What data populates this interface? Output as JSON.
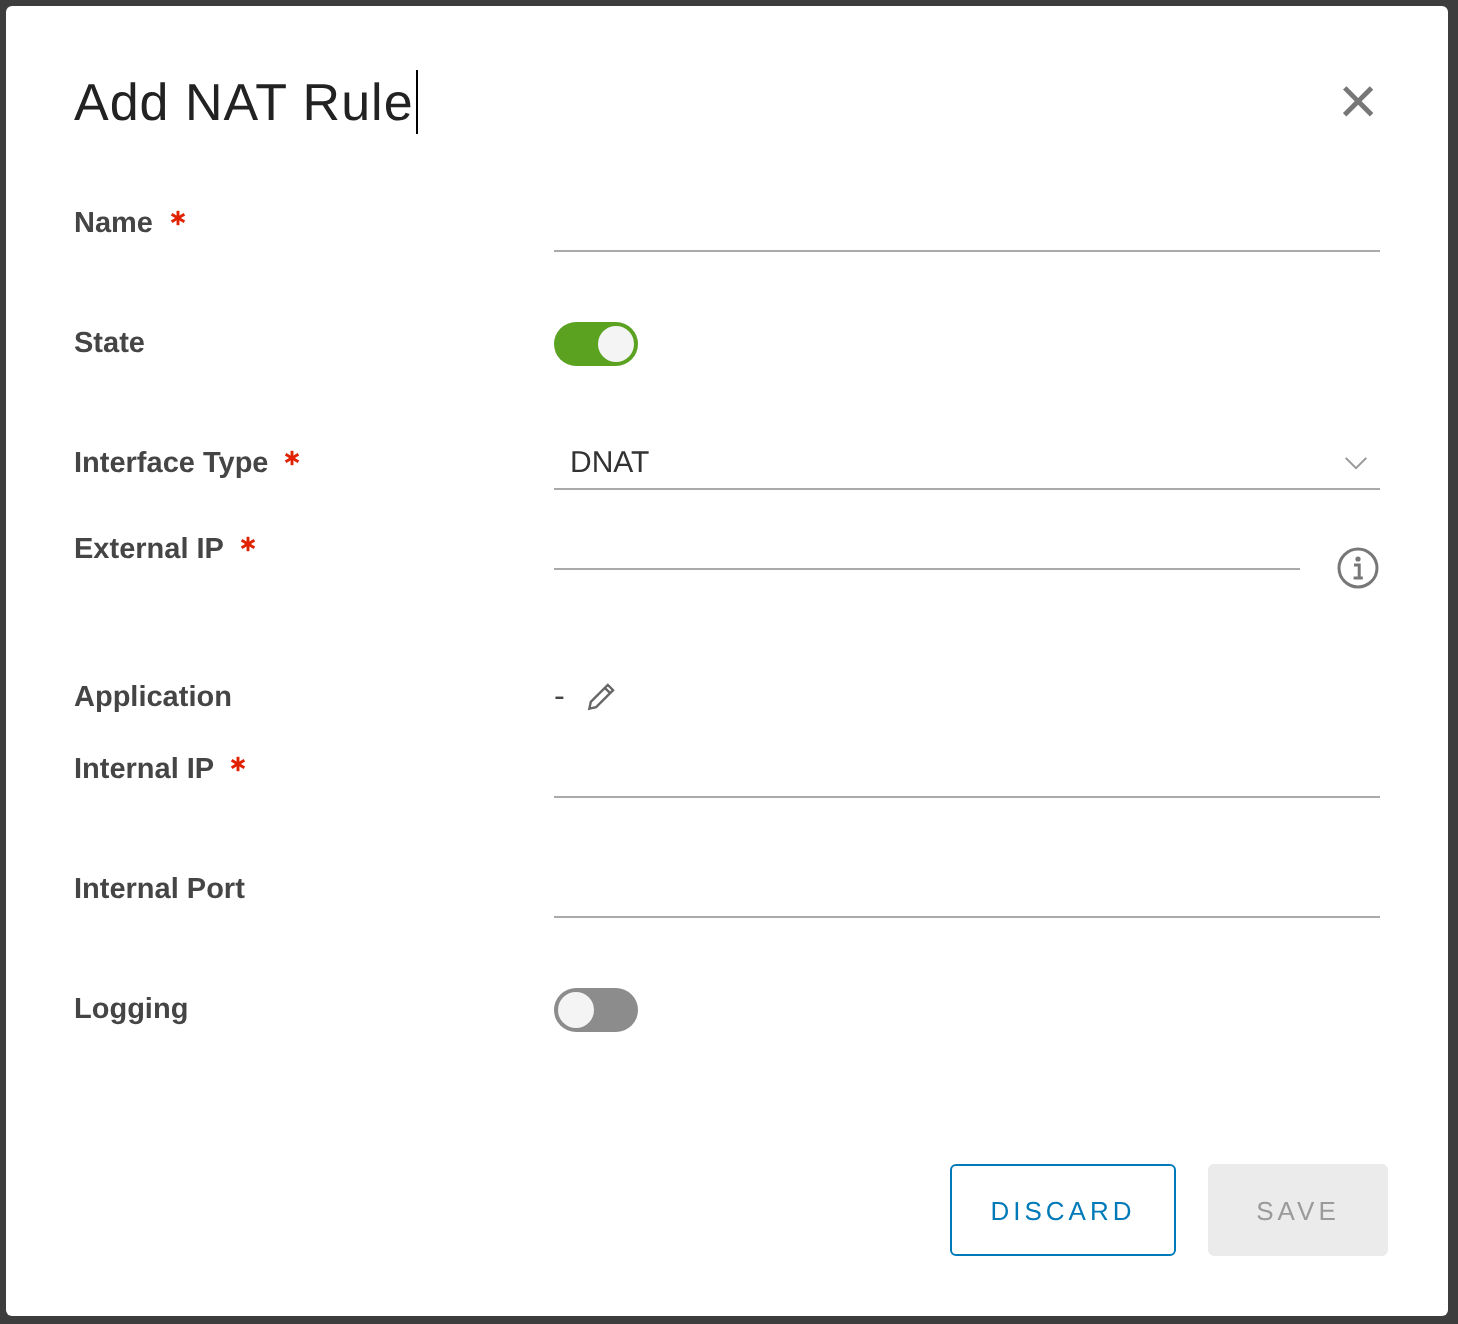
{
  "dialog": {
    "title": "Add NAT Rule",
    "close": "×"
  },
  "fields": [
    {
      "kind": "text",
      "label": "Name",
      "required": true
    },
    {
      "kind": "toggle",
      "label": "State",
      "on": true
    },
    {
      "kind": "select",
      "label": "Interface Type",
      "required": true,
      "value": "DNAT"
    },
    {
      "kind": "text-info",
      "label": "External IP",
      "required": true
    },
    {
      "kind": "value-edit",
      "label": "Application",
      "value": "-"
    },
    {
      "kind": "text",
      "label": "Internal IP",
      "required": true
    },
    {
      "kind": "text",
      "label": "Internal Port",
      "required": false
    },
    {
      "kind": "toggle",
      "label": "Logging",
      "on": false
    }
  ],
  "buttons": [
    {
      "label": "DISCARD",
      "disabled": false
    },
    {
      "label": "SAVE",
      "disabled": true
    }
  ]
}
